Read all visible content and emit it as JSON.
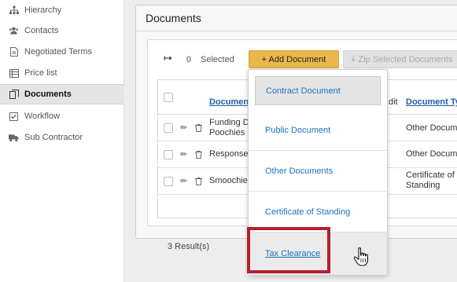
{
  "sidebar": {
    "items": [
      {
        "label": "Hierarchy",
        "icon": "sitemap-icon"
      },
      {
        "label": "Contacts",
        "icon": "users-icon"
      },
      {
        "label": "Negotiated Terms",
        "icon": "document-icon"
      },
      {
        "label": "Price list",
        "icon": "list-icon"
      },
      {
        "label": "Documents",
        "icon": "copy-icon",
        "active": true
      },
      {
        "label": "Workflow",
        "icon": "checkbox-icon"
      },
      {
        "label": "Sub Contractor",
        "icon": "truck-icon"
      }
    ]
  },
  "panel": {
    "title": "Documents"
  },
  "toolbar": {
    "selected_count": "0",
    "selected_label": "Selected",
    "add_label": "+ Add Document",
    "zip_label": "Zip Selected Documents"
  },
  "table": {
    "headers": {
      "document": "Document",
      "edit": "dit",
      "type": "Document Typ"
    },
    "rows": [
      {
        "name": "Funding Do Poochies",
        "type": "Other Docume"
      },
      {
        "name": "Response #",
        "type": "Other Docume"
      },
      {
        "name": "Smoochie's",
        "type": "Certificate of Standing"
      }
    ],
    "results": "3 Result(s)"
  },
  "dropdown": {
    "items": [
      "Contract Document",
      "Public Document",
      "Other Documents",
      "Certificate of Standing",
      "Tax Clearance"
    ]
  },
  "colors": {
    "accent_button": "#e9b74a",
    "link": "#1f72b8",
    "highlight": "#b5202e"
  }
}
